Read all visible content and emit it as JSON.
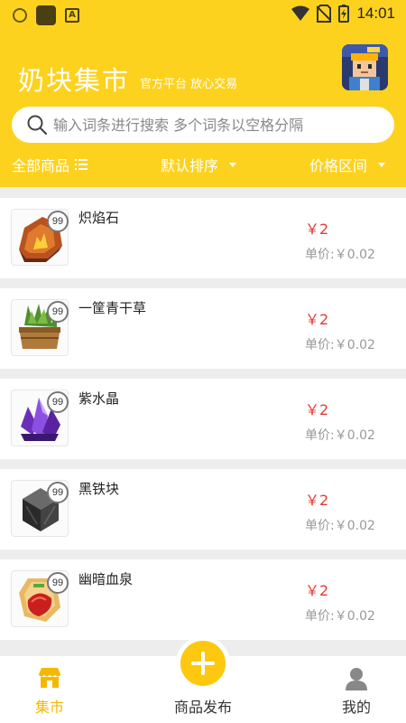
{
  "status_bar": {
    "time": "14:01",
    "left_icons": [
      "shield-icon",
      "app-icon",
      "a-badge-icon"
    ],
    "right_icons": [
      "wifi-icon",
      "no-sim-icon",
      "battery-charging-icon"
    ]
  },
  "header": {
    "title": "奶块集市",
    "subtitle": "官方平台 放心交易",
    "avatar_icon": "game-character-avatar"
  },
  "search": {
    "placeholder": "输入词条进行搜索 多个词条以空格分隔",
    "value": ""
  },
  "filters": {
    "all_label": "全部商品",
    "sort_label": "默认排序",
    "price_label": "价格区间"
  },
  "items": [
    {
      "name": "炽焰石",
      "badge": "99",
      "price": "￥2",
      "unit_price": "单价:￥0.02",
      "icon": "blaze-stone-icon"
    },
    {
      "name": "一筐青干草",
      "badge": "99",
      "price": "￥2",
      "unit_price": "单价:￥0.02",
      "icon": "hay-basket-icon"
    },
    {
      "name": "紫水晶",
      "badge": "99",
      "price": "￥2",
      "unit_price": "单价:￥0.02",
      "icon": "amethyst-icon"
    },
    {
      "name": "黑铁块",
      "badge": "99",
      "price": "￥2",
      "unit_price": "单价:￥0.02",
      "icon": "black-iron-block-icon"
    },
    {
      "name": "幽暗血泉",
      "badge": "99",
      "price": "￥2",
      "unit_price": "单价:￥0.02",
      "icon": "dark-blood-spring-icon"
    }
  ],
  "bottom_nav": {
    "market_label": "集市",
    "publish_label": "商品发布",
    "mine_label": "我的"
  },
  "colors": {
    "brand_yellow": "#fdd21f",
    "price_red": "#e53935",
    "active_nav": "#f5b800"
  }
}
